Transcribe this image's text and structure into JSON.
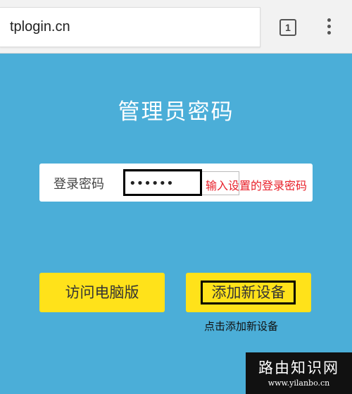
{
  "browser": {
    "url": "tplogin.cn",
    "tab_count": "1"
  },
  "page": {
    "title": "管理员密码"
  },
  "login": {
    "label": "登录密码",
    "password_value": "••••••",
    "hint": "输入设置的登录密码"
  },
  "buttons": {
    "pc_version": "访问电脑版",
    "add_device": "添加新设备",
    "add_device_hint": "点击添加新设备"
  },
  "watermark": {
    "title": "路由知识网",
    "url": "www.yilanbo.cn"
  },
  "colors": {
    "background": "#4baed8",
    "button": "#ffe21a",
    "hint_red": "#e8202a"
  },
  "icons": {
    "tabs": "tab-count-icon",
    "menu": "more-vert-icon"
  }
}
